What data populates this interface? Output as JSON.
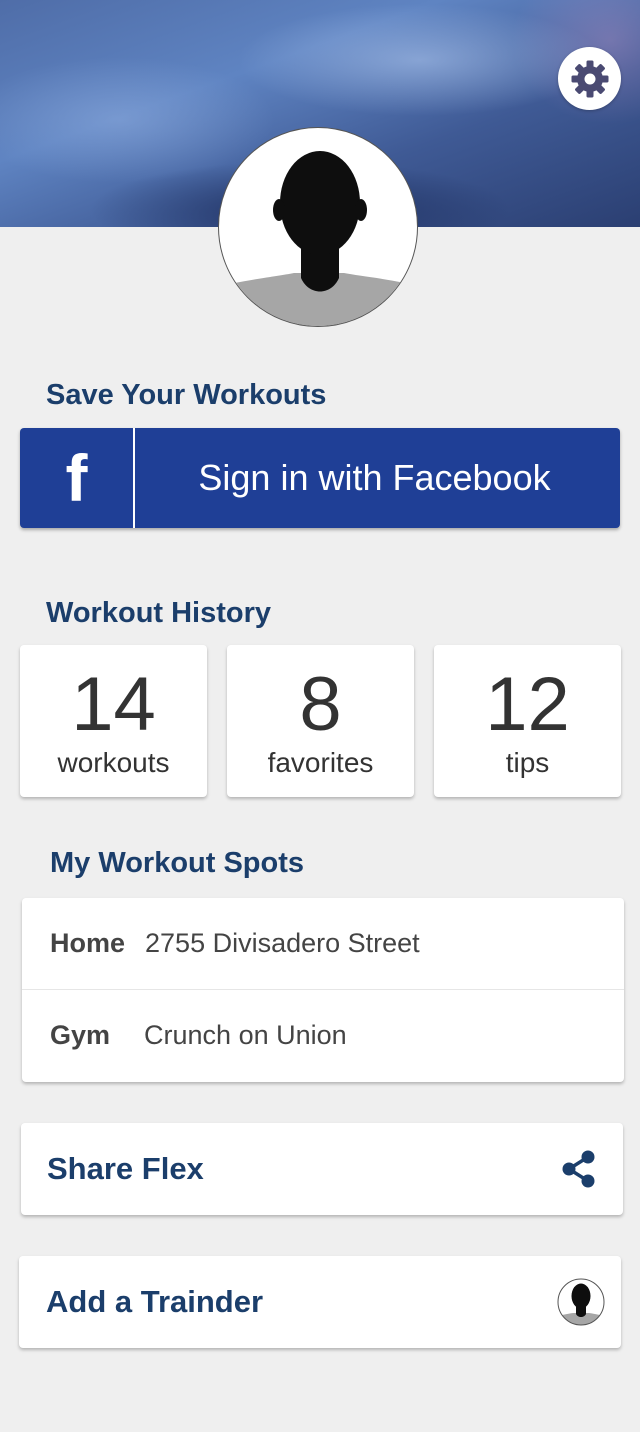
{
  "header": {
    "settings_icon": "gear-icon",
    "avatar_icon": "person-silhouette-icon"
  },
  "save_section": {
    "title": "Save Your Workouts",
    "facebook_icon": "f",
    "facebook_label": "Sign in with Facebook",
    "facebook_color": "#1f3f96"
  },
  "history": {
    "title": "Workout History",
    "stats": [
      {
        "value": "14",
        "label": "workouts"
      },
      {
        "value": "8",
        "label": "favorites"
      },
      {
        "value": "12",
        "label": "tips"
      }
    ]
  },
  "spots": {
    "title": "My Workout Spots",
    "items": [
      {
        "key": "Home",
        "value": "2755 Divisadero Street"
      },
      {
        "key": "Gym",
        "value": "Crunch on Union"
      }
    ]
  },
  "share": {
    "label": "Share Flex",
    "icon": "share-icon"
  },
  "trainder": {
    "label": "Add a Trainder",
    "icon": "person-silhouette-icon"
  },
  "colors": {
    "title": "#1b3e6b",
    "background": "#efefef"
  }
}
